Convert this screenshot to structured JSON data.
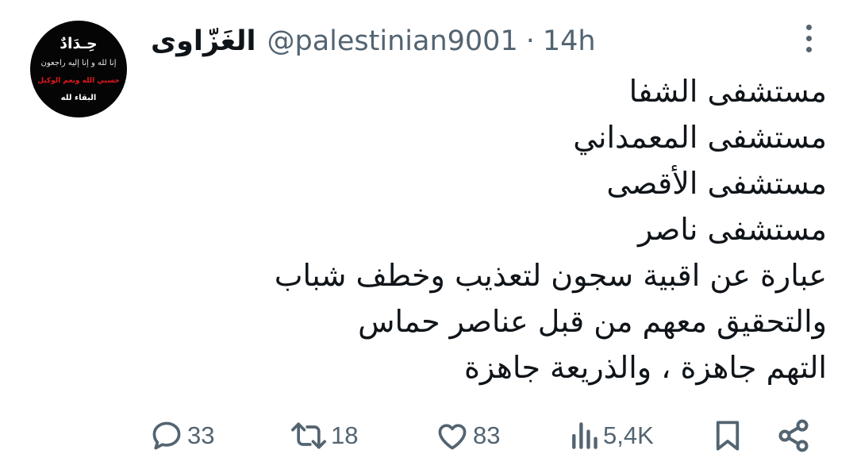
{
  "avatar": {
    "title": "حِـدَادٌ",
    "line1": "إنا لله و إنا إليه راجعون",
    "line2": "حسبي الله ونعم الوكيل",
    "line3": "البقاء لله"
  },
  "header": {
    "display_name": "الغَزّاوى",
    "handle": "@palestinian9001",
    "separator": "·",
    "time": "14h"
  },
  "tweet": {
    "lines": [
      "مستشفى الشفا",
      "مستشفى المعمداني",
      "مستشفى الأقصى",
      "مستشفى ناصر",
      "عبارة عن اقبية سجون لتعذيب وخطف شباب",
      "والتحقيق معهم من قبل عناصر حماس",
      "التهم جاهزة ، والذريعة جاهزة"
    ]
  },
  "actions": {
    "replies": "33",
    "reposts": "18",
    "likes": "83",
    "views": "5,4K"
  },
  "icons": {
    "reply": "reply-icon",
    "repost": "repost-icon",
    "like": "heart-icon",
    "views": "views-icon",
    "bookmark": "bookmark-icon",
    "share": "share-icon",
    "more": "more-vertical-icon"
  },
  "colors": {
    "text": "#0f1419",
    "secondary": "#536471",
    "background": "#ffffff"
  }
}
